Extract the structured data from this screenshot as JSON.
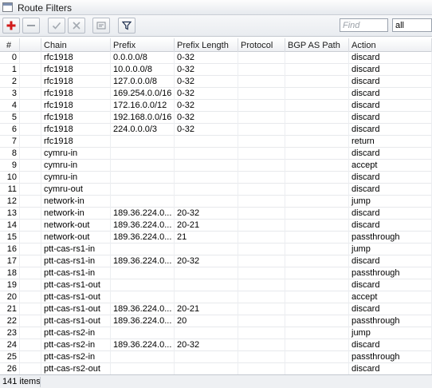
{
  "window": {
    "title": "Route Filters"
  },
  "toolbar": {
    "find_placeholder": "Find",
    "filter_select_value": "all"
  },
  "columns": [
    "#",
    "",
    "Chain",
    "Prefix",
    "Prefix Length",
    "Protocol",
    "BGP AS Path",
    "Action"
  ],
  "rows": [
    {
      "num": "0",
      "chain": "rfc1918",
      "prefix": "0.0.0.0/8",
      "plen": "0-32",
      "action": "discard"
    },
    {
      "num": "1",
      "chain": "rfc1918",
      "prefix": "10.0.0.0/8",
      "plen": "0-32",
      "action": "discard"
    },
    {
      "num": "2",
      "chain": "rfc1918",
      "prefix": "127.0.0.0/8",
      "plen": "0-32",
      "action": "discard"
    },
    {
      "num": "3",
      "chain": "rfc1918",
      "prefix": "169.254.0.0/16",
      "plen": "0-32",
      "action": "discard"
    },
    {
      "num": "4",
      "chain": "rfc1918",
      "prefix": "172.16.0.0/12",
      "plen": "0-32",
      "action": "discard"
    },
    {
      "num": "5",
      "chain": "rfc1918",
      "prefix": "192.168.0.0/16",
      "plen": "0-32",
      "action": "discard"
    },
    {
      "num": "6",
      "chain": "rfc1918",
      "prefix": "224.0.0.0/3",
      "plen": "0-32",
      "action": "discard"
    },
    {
      "num": "7",
      "chain": "rfc1918",
      "prefix": "",
      "plen": "",
      "action": "return"
    },
    {
      "num": "8",
      "chain": "cymru-in",
      "prefix": "",
      "plen": "",
      "action": "discard"
    },
    {
      "num": "9",
      "chain": "cymru-in",
      "prefix": "",
      "plen": "",
      "action": "accept"
    },
    {
      "num": "10",
      "chain": "cymru-in",
      "prefix": "",
      "plen": "",
      "action": "discard"
    },
    {
      "num": "11",
      "chain": "cymru-out",
      "prefix": "",
      "plen": "",
      "action": "discard"
    },
    {
      "num": "12",
      "chain": "network-in",
      "prefix": "",
      "plen": "",
      "action": "jump"
    },
    {
      "num": "13",
      "chain": "network-in",
      "prefix": "189.36.224.0...",
      "plen": "20-32",
      "action": "discard"
    },
    {
      "num": "14",
      "chain": "network-out",
      "prefix": "189.36.224.0...",
      "plen": "20-21",
      "action": "discard"
    },
    {
      "num": "15",
      "chain": "network-out",
      "prefix": "189.36.224.0...",
      "plen": "21",
      "action": "passthrough"
    },
    {
      "num": "16",
      "chain": "ptt-cas-rs1-in",
      "prefix": "",
      "plen": "",
      "action": "jump"
    },
    {
      "num": "17",
      "chain": "ptt-cas-rs1-in",
      "prefix": "189.36.224.0...",
      "plen": "20-32",
      "action": "discard"
    },
    {
      "num": "18",
      "chain": "ptt-cas-rs1-in",
      "prefix": "",
      "plen": "",
      "action": "passthrough"
    },
    {
      "num": "19",
      "chain": "ptt-cas-rs1-out",
      "prefix": "",
      "plen": "",
      "action": "discard"
    },
    {
      "num": "20",
      "chain": "ptt-cas-rs1-out",
      "prefix": "",
      "plen": "",
      "action": "accept"
    },
    {
      "num": "21",
      "chain": "ptt-cas-rs1-out",
      "prefix": "189.36.224.0...",
      "plen": "20-21",
      "action": "discard"
    },
    {
      "num": "22",
      "chain": "ptt-cas-rs1-out",
      "prefix": "189.36.224.0...",
      "plen": "20",
      "action": "passthrough"
    },
    {
      "num": "23",
      "chain": "ptt-cas-rs2-in",
      "prefix": "",
      "plen": "",
      "action": "jump"
    },
    {
      "num": "24",
      "chain": "ptt-cas-rs2-in",
      "prefix": "189.36.224.0...",
      "plen": "20-32",
      "action": "discard"
    },
    {
      "num": "25",
      "chain": "ptt-cas-rs2-in",
      "prefix": "",
      "plen": "",
      "action": "passthrough"
    },
    {
      "num": "26",
      "chain": "ptt-cas-rs2-out",
      "prefix": "",
      "plen": "",
      "action": "discard"
    }
  ],
  "status": {
    "count": "141 items"
  },
  "icons": {
    "add": "plus-icon",
    "remove": "minus-icon",
    "enable": "check-icon",
    "disable": "x-icon",
    "comment": "comment-icon",
    "filter": "filter-icon"
  },
  "colors": {
    "add_icon": "#d11a1a"
  }
}
